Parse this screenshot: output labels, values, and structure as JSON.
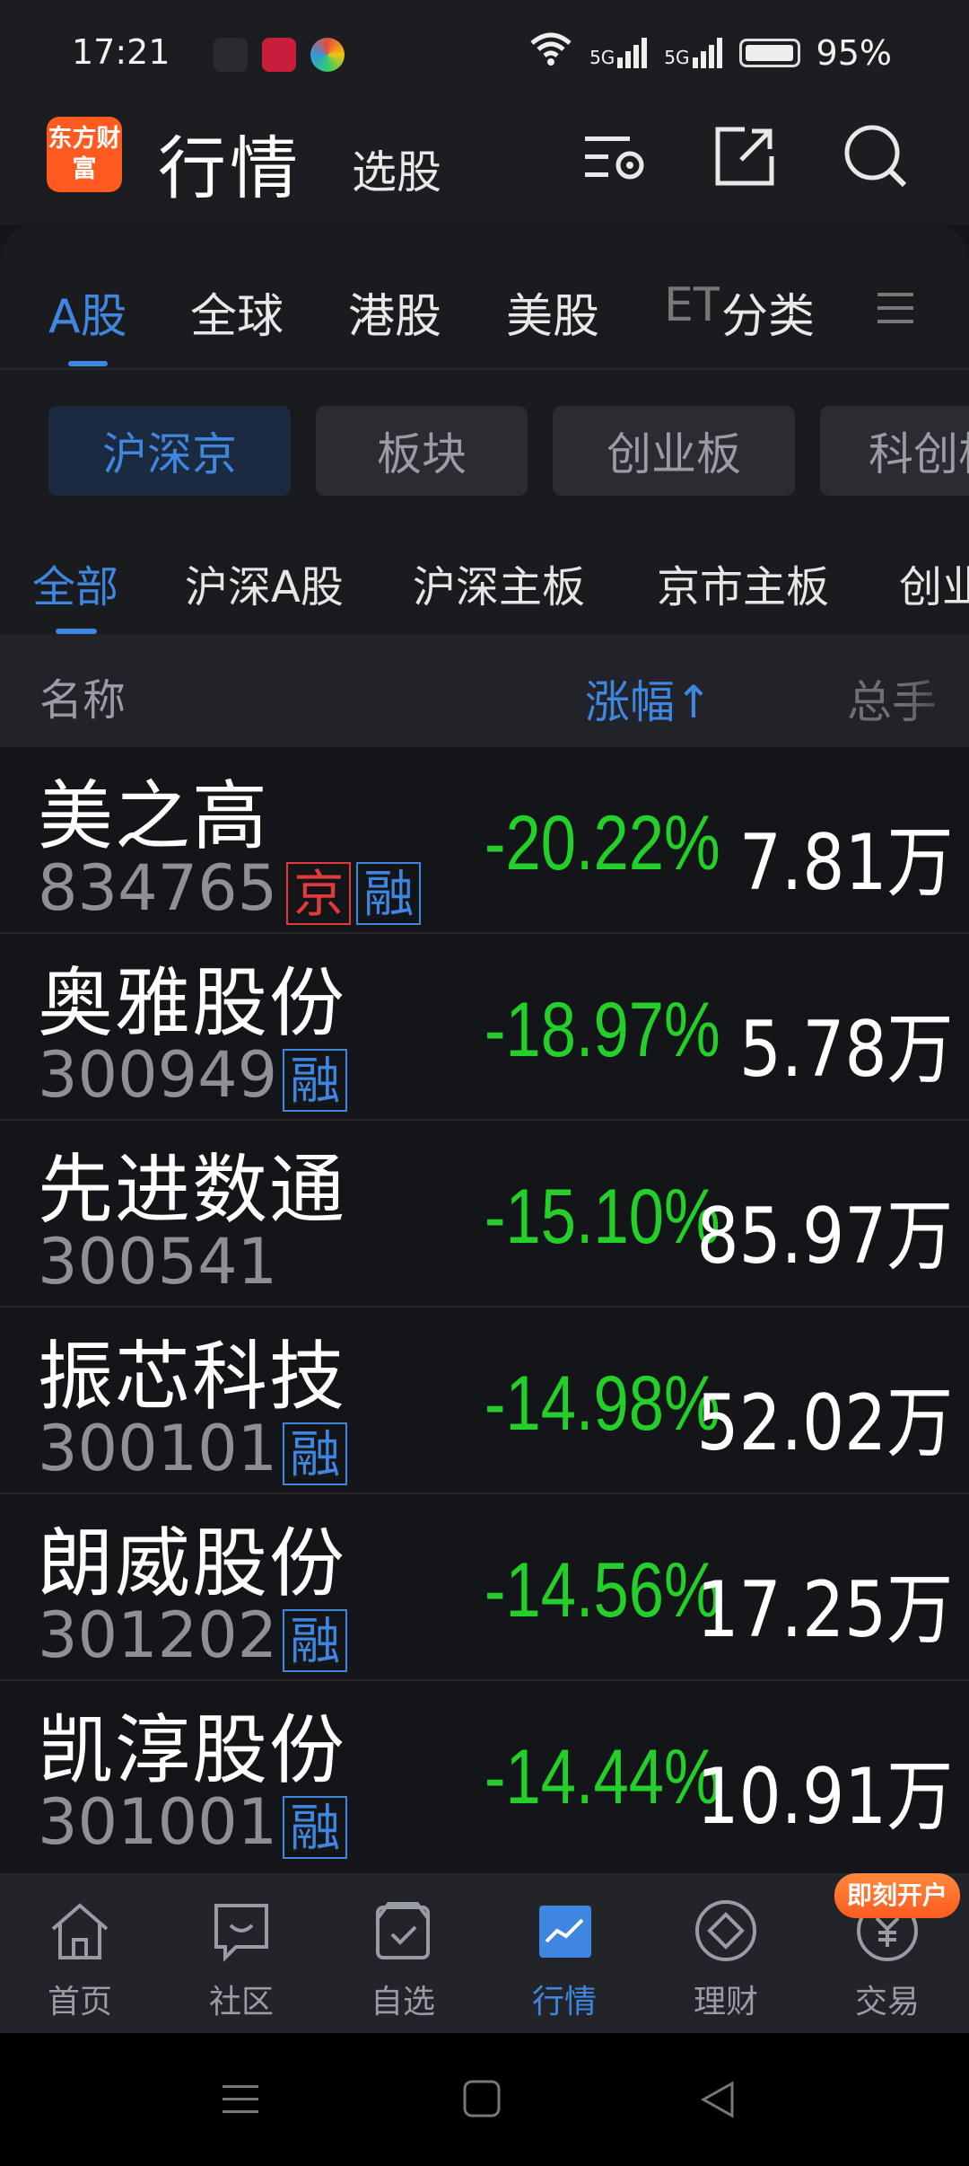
{
  "status_bar": {
    "time": "17:21",
    "battery": "95%",
    "signal_label": "5G"
  },
  "header": {
    "logo_text": "东方财富",
    "title": "行情",
    "subtitle": "选股"
  },
  "market_tabs": [
    {
      "label": "A股",
      "active": true
    },
    {
      "label": "全球"
    },
    {
      "label": "港股"
    },
    {
      "label": "美股"
    },
    {
      "label": "ET"
    },
    {
      "label": "分类"
    }
  ],
  "board_chips": [
    {
      "label": "沪深京",
      "active": true
    },
    {
      "label": "板块"
    },
    {
      "label": "创业板"
    },
    {
      "label": "科创板"
    }
  ],
  "filter_tabs": [
    {
      "label": "全部",
      "active": true
    },
    {
      "label": "沪深A股"
    },
    {
      "label": "沪深主板"
    },
    {
      "label": "京市主板"
    },
    {
      "label": "创业"
    }
  ],
  "table_header": {
    "name": "名称",
    "change": "涨幅↑",
    "volume": "总手"
  },
  "rows": [
    {
      "name": "美之高",
      "code": "834765",
      "tags": [
        "京",
        "融"
      ],
      "change": "-20.22%",
      "volume": "7.81万"
    },
    {
      "name": "奥雅股份",
      "code": "300949",
      "tags": [
        "融"
      ],
      "change": "-18.97%",
      "volume": "5.78万"
    },
    {
      "name": "先进数通",
      "code": "300541",
      "tags": [],
      "change": "-15.10%",
      "volume": "85.97万"
    },
    {
      "name": "振芯科技",
      "code": "300101",
      "tags": [
        "融"
      ],
      "change": "-14.98%",
      "volume": "52.02万"
    },
    {
      "name": "朗威股份",
      "code": "301202",
      "tags": [
        "融"
      ],
      "change": "-14.56%",
      "volume": "17.25万"
    },
    {
      "name": "凯淳股份",
      "code": "301001",
      "tags": [
        "融"
      ],
      "change": "-14.44%",
      "volume": "10.91万"
    }
  ],
  "bottom_nav": [
    {
      "label": "首页",
      "icon": "home-icon"
    },
    {
      "label": "社区",
      "icon": "community-icon"
    },
    {
      "label": "自选",
      "icon": "watchlist-icon"
    },
    {
      "label": "行情",
      "icon": "market-icon",
      "active": true
    },
    {
      "label": "理财",
      "icon": "wealth-icon"
    },
    {
      "label": "交易",
      "icon": "trade-icon"
    }
  ],
  "promo_badge": "即刻开户",
  "colors": {
    "accent": "#3f86e0",
    "down": "#23d029",
    "up": "#e03a3a",
    "brand": "#ff5a1f"
  }
}
